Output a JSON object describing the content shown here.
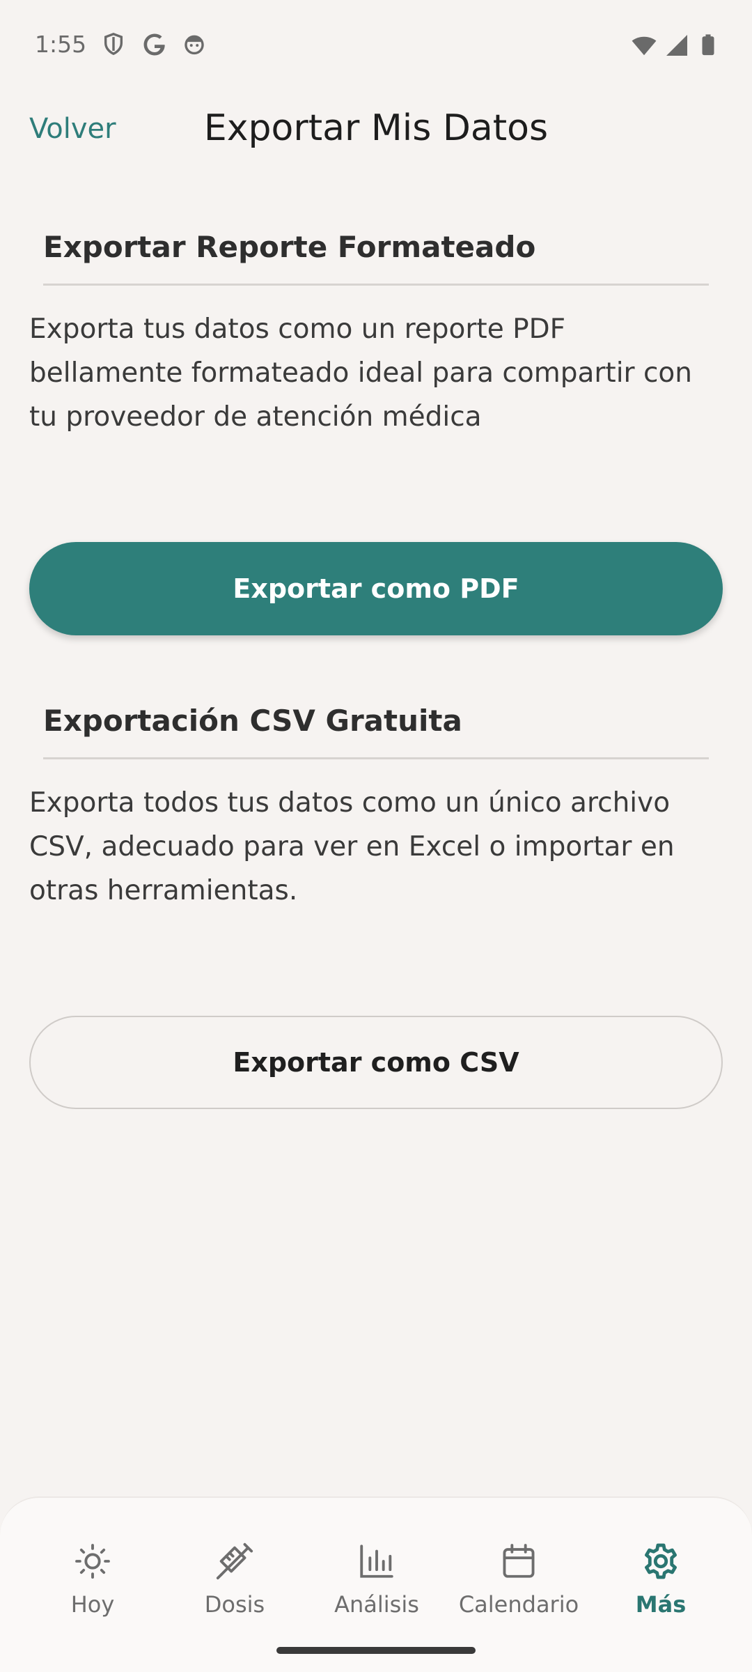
{
  "status_bar": {
    "time": "1:55",
    "left_icons": [
      "shield-icon",
      "google-icon",
      "face-icon"
    ],
    "right_icons": [
      "wifi-icon",
      "signal-icon",
      "battery-icon"
    ]
  },
  "header": {
    "back_label": "Volver",
    "title": "Exportar Mis Datos"
  },
  "sections": [
    {
      "title": "Exportar Reporte Formateado",
      "description": "Exporta tus datos como un reporte PDF bellamente formateado ideal para compartir con tu proveedor de atención médica",
      "button_label": "Exportar como PDF"
    },
    {
      "title": "Exportación CSV Gratuita",
      "description": "Exporta todos tus datos como un único archivo CSV, adecuado para ver en Excel o importar en otras herramientas.",
      "button_label": "Exportar como CSV"
    }
  ],
  "bottom_nav": {
    "items": [
      {
        "label": "Hoy",
        "icon": "sun-icon"
      },
      {
        "label": "Dosis",
        "icon": "syringe-icon"
      },
      {
        "label": "Análisis",
        "icon": "bar-chart-icon"
      },
      {
        "label": "Calendario",
        "icon": "calendar-icon"
      },
      {
        "label": "Más",
        "icon": "gear-icon"
      }
    ],
    "active": "Más"
  },
  "colors": {
    "accent": "#2e7f7a",
    "background": "#f6f3f1",
    "nav_active": "#2a7671"
  }
}
